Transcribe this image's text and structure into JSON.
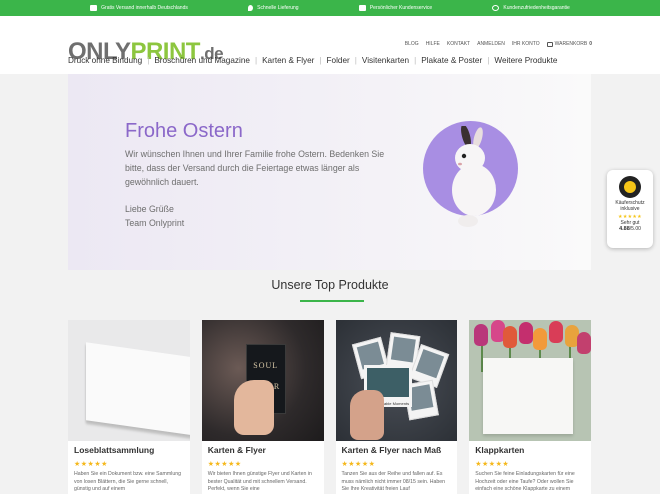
{
  "topbar": {
    "items": [
      {
        "label": "Gratis Versand innerhalb Deutschlands",
        "icon": "truck-icon"
      },
      {
        "label": "Schnelle Lieferung",
        "icon": "drop-icon"
      },
      {
        "label": "Persönlicher Kundenservice",
        "icon": "thumbs-up-icon"
      },
      {
        "label": "Kundenzufriedenheitsgarantie",
        "icon": "smiley-icon"
      }
    ],
    "color": "#3bb54a"
  },
  "logo": {
    "only": "ONLY",
    "print": "PRINT",
    "de": ".de"
  },
  "meta_links": [
    "BLOG",
    "HILFE",
    "KONTAKT",
    "ANMELDEN",
    "IHR KONTO"
  ],
  "cart": {
    "label": "WARENKORB",
    "count": "0"
  },
  "mainnav": [
    "Druck ohne Bindung",
    "Broschüren und Magazine",
    "Karten & Flyer",
    "Folder",
    "Visitenkarten",
    "Plakate & Poster",
    "Weitere Produkte"
  ],
  "hero": {
    "title": "Frohe Ostern",
    "text": "Wir wünschen Ihnen und Ihrer Familie frohe Ostern. Bedenken Sie bitte, dass der Versand durch die Feiertage etwas länger als gewöhnlich dauert.",
    "greeting": "Liebe Grüße",
    "team": "Team Onlyprint",
    "accent": "#8b68c9"
  },
  "trust_badge": {
    "label": "Käuferschutz inklusive",
    "stars": "★★★★★",
    "rating_word": "Sehr gut",
    "score": "4.88",
    "scale": "/5.00"
  },
  "section": {
    "title": "Unsere Top Produkte"
  },
  "products": [
    {
      "title": "Loseblattsammlung",
      "stars": "★★★★★",
      "desc": "Haben Sie ein Dokument bzw. eine Sammlung von losen Blättern, die Sie gerne schnell, günstig und auf einem"
    },
    {
      "title": "Karten & Flyer",
      "stars": "★★★★★",
      "desc": "Wir bieten Ihnen günstige Flyer und Karten in bester Qualität und mit schnellem Versand. Perfekt, wenn Sie eine"
    },
    {
      "title": "Karten & Flyer nach Maß",
      "stars": "★★★★★",
      "desc": "Tanzen Sie aus der Reihe und fallen auf. Es muss nämlich nicht immer 08/15 sein. Haben Sie Ihre Kreativität freien Lauf"
    },
    {
      "title": "Klappkarten",
      "stars": "★★★★★",
      "desc": "Suchen Sie feine Einladungskarten für eine Hochzeit oder eine Taufe? Oder wollen Sie einfach eine schöne Klappkarte zu einem"
    }
  ],
  "flyer_image": {
    "line1": "SOUL",
    "line2": "RIVER"
  },
  "photo_image": {
    "caption": "Unforgettable Moments"
  }
}
